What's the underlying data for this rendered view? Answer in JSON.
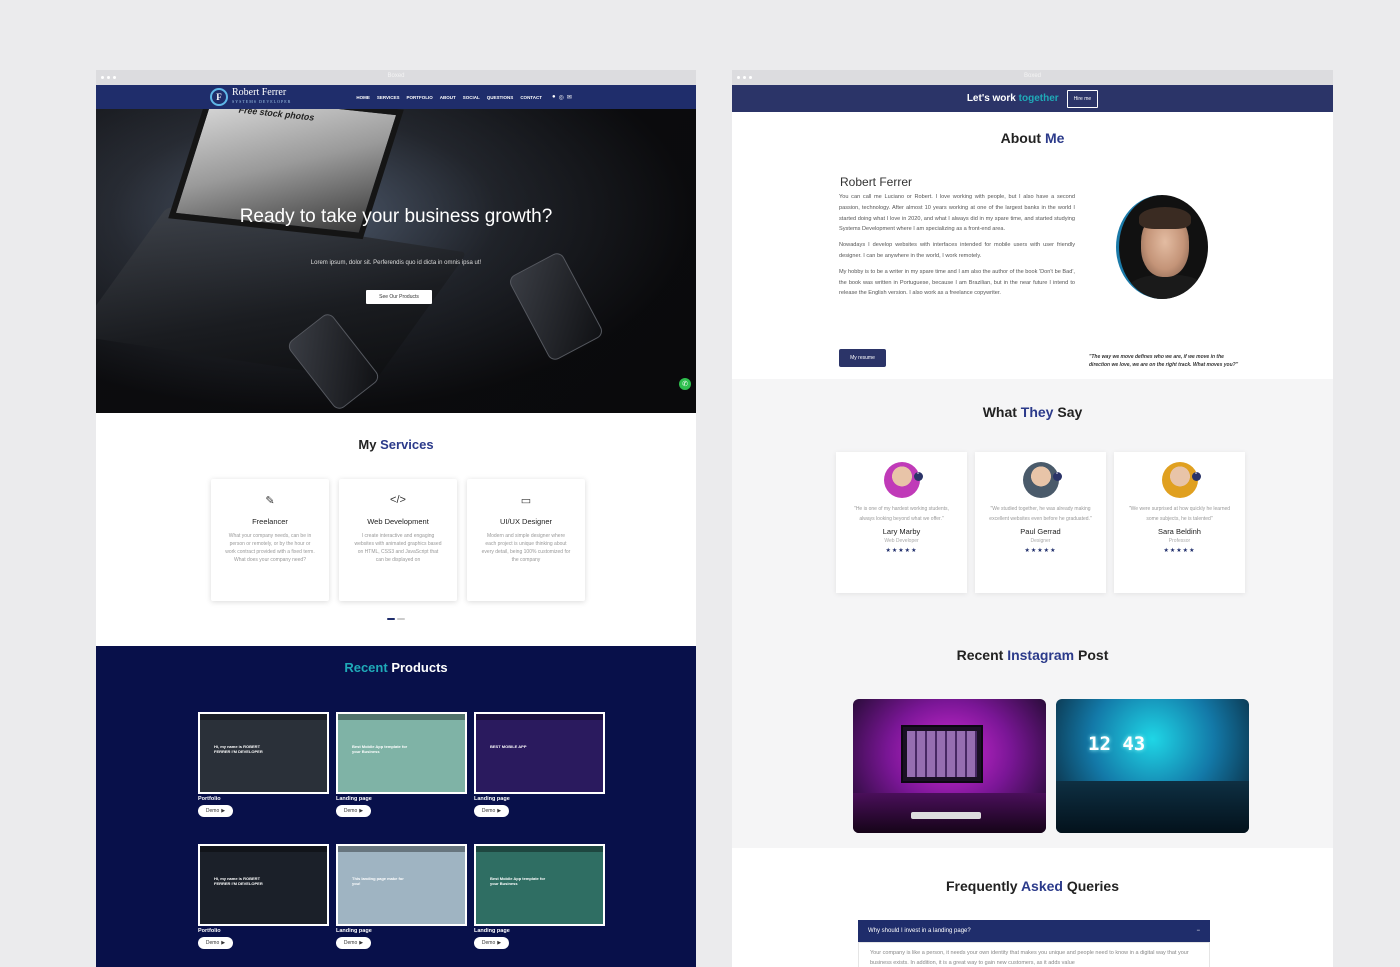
{
  "left_window": {
    "chrome_title": "Boxed",
    "nav": {
      "logo_initials": "F",
      "logo_name": "Robert Ferrer",
      "logo_sub": "SYSTEMS DEVELOPER",
      "menu": [
        "HOME",
        "SERVICES",
        "PORTFOLIO",
        "ABOUT",
        "SOCIAL",
        "QUESTIONS",
        "CONTACT"
      ],
      "icons": [
        "facebook-icon",
        "instagram-icon",
        "mail-icon"
      ]
    },
    "hero": {
      "screen_text": "Free stock photos",
      "title": "Ready to take your business growth?",
      "text": "Lorem ipsum, dolor sit. Perferendis quo id dicta in omnis ipsa ut!",
      "button": "See Our Products"
    },
    "services": {
      "heading_a": "My",
      "heading_b": "Services",
      "cards": [
        {
          "icon": "edit-icon",
          "title": "Freelancer",
          "desc": "What your company needs, can be in person or remotely, or by the hour or work contract provided with a fixed term. What does your company need?"
        },
        {
          "icon": "code-icon",
          "title": "Web Development",
          "desc": "I create interactive and engaging websites with animated graphics based on HTML, CSS3 and JavaScript that can be displayed on"
        },
        {
          "icon": "monitor-icon",
          "title": "UI/UX Designer",
          "desc": "Modern and simple designer where each project is unique thinking about every detail, being 100% customized for the company"
        }
      ]
    },
    "products": {
      "heading_a": "Recent",
      "heading_b": "Products",
      "demo_label": "Demo",
      "items": [
        {
          "label": "Portfolio",
          "thumb_text": "Hi, my name is ROBERT FERRER I'M DEVELOPER",
          "bg": "#2a3039"
        },
        {
          "label": "Landing page",
          "thumb_text": "Best Mobile App template for your Business",
          "bg": "#7fb3a6"
        },
        {
          "label": "Landing page",
          "thumb_text": "BEST MOBILE APP",
          "bg": "#2a1a5e"
        },
        {
          "label": "Portfolio",
          "thumb_text": "Hi, my name is ROBERT FERRER I'M DEVELOPER",
          "bg": "#1b2029"
        },
        {
          "label": "Landing page",
          "thumb_text": "This landing page make for you!",
          "bg": "#9fb4c2"
        },
        {
          "label": "Landing page",
          "thumb_text": "Best Mobile App template for your Business",
          "bg": "#2f6e63"
        }
      ]
    }
  },
  "right_window": {
    "chrome_title": "Boxed",
    "nav": {
      "title_a": "Let's work",
      "title_b": "together",
      "button": "Hire me"
    },
    "about": {
      "heading_a": "About",
      "heading_b": "Me",
      "name": "Robert Ferrer",
      "p1": "You can call me Luciano or Robert. I love working with people, but I also have a second passion, technology. After almost 10 years working at one of the largest banks in the world I started doing what I love in 2020, and what I always did in my spare time, and started studying Systems Development where I am specializing as a front-end area.",
      "p2": "Nowadays I develop websites with interfaces intended for mobile users with user friendly designer. I can be anywhere in the world, I work remotely.",
      "p3": "My hobby is to be a writer in my spare time and I am also the author of the book 'Don't be Bad', the book was written in Portuguese, because I am Brazilian, but in the near future I intend to release the English version. I also work as a freelance copywriter.",
      "button": "My resume",
      "quote": "\"The way we move defines who we are, if we move in the direction we love, we are on the right track. What moves you?\""
    },
    "testimonials": {
      "heading_a": "What",
      "heading_b": "They",
      "heading_c": "Say",
      "stars": "★★★★★",
      "items": [
        {
          "quote": "\"He is one of my hardest working students, always looking beyond what we offer.\"",
          "name": "Lary Marby",
          "role": "Web Developer",
          "avatar_color": "#c03ab8"
        },
        {
          "quote": "\"We studied together, he was already making excellent websites even before he graduated.\"",
          "name": "Paul Gerrad",
          "role": "Designer",
          "avatar_color": "#4a5a6a"
        },
        {
          "quote": "\"We were surprised at how quickly he learned some subjects, he is talented\"",
          "name": "Sara Beldinh",
          "role": "Professor",
          "avatar_color": "#e0a020"
        }
      ]
    },
    "instagram": {
      "heading_a": "Recent",
      "heading_b": "Instagram",
      "heading_c": "Post",
      "clock": "12 43"
    },
    "faq": {
      "heading_a": "Frequently",
      "heading_b": "Asked",
      "heading_c": "Queries",
      "question": "Why should I invest in a landing page?",
      "toggle": "−",
      "answer": "Your company is like a person, it needs your own identity that makes you unique and people need to know in a digital way that your business exists. In addition, it is a great way to gain new customers, as it adds value"
    }
  }
}
